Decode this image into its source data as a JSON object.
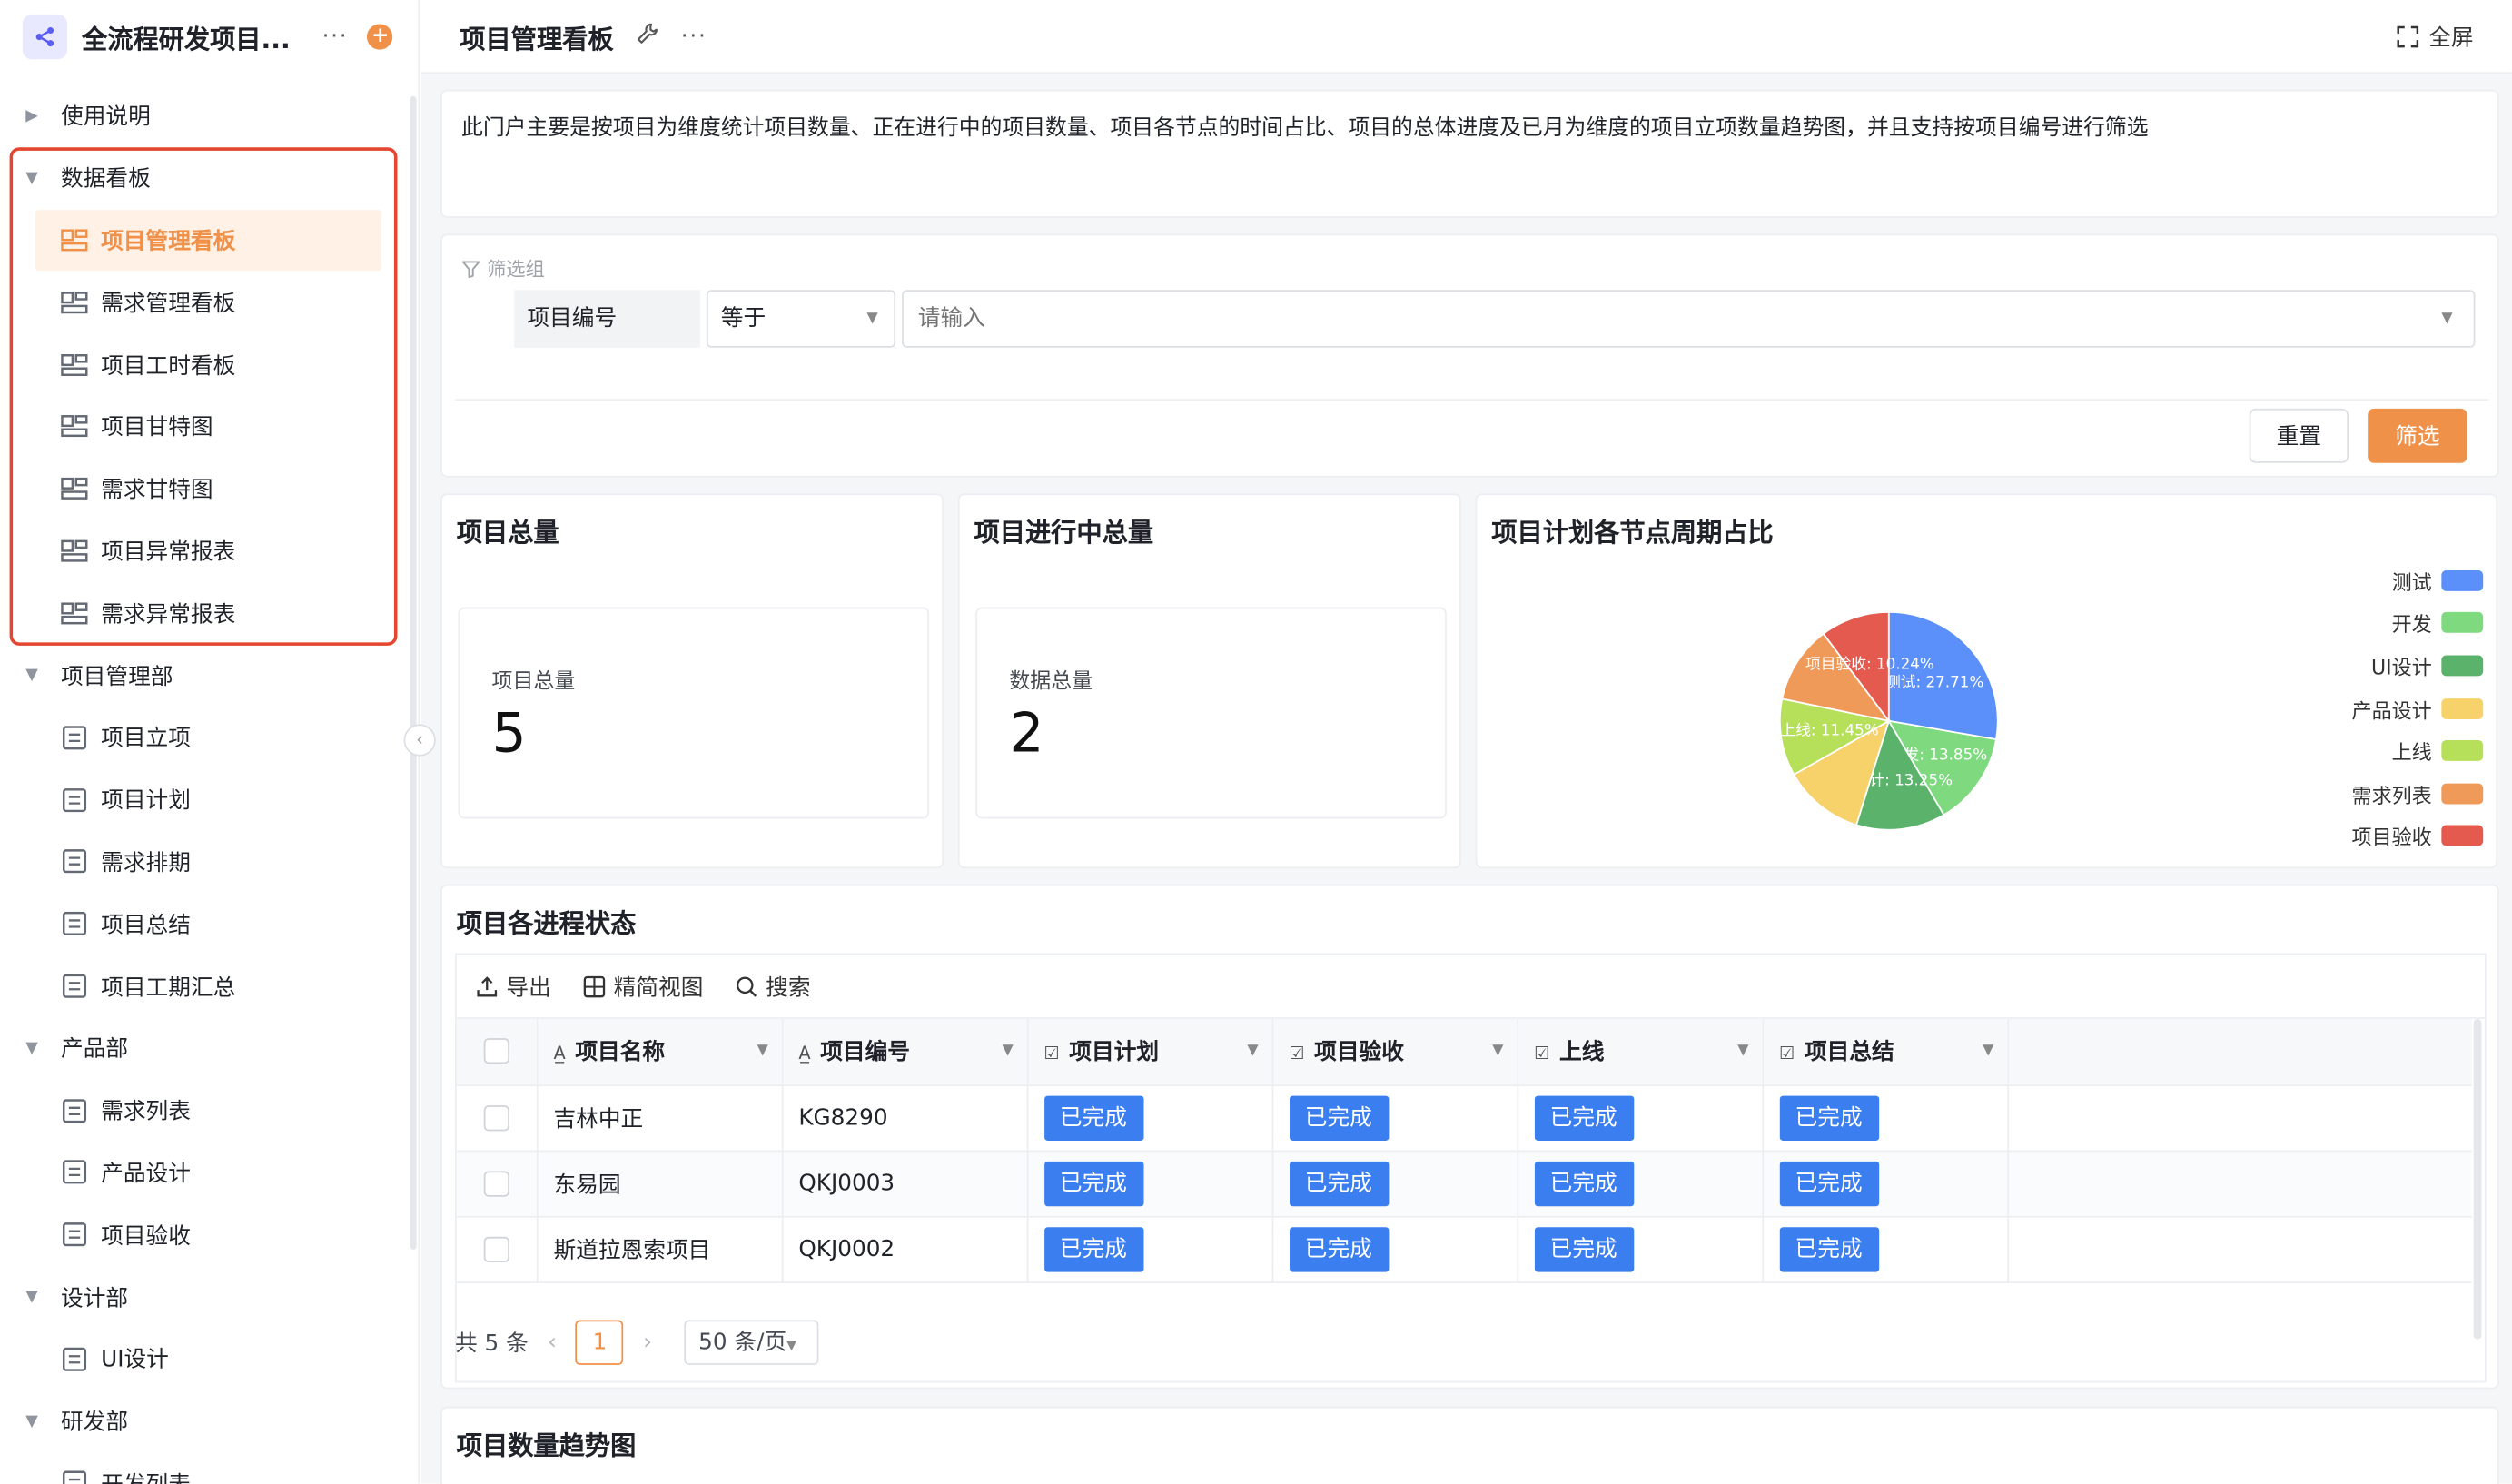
{
  "app": {
    "title": "全流程研发项目...",
    "more": "···",
    "add": "+"
  },
  "sidebar": {
    "groups": [
      {
        "label": "使用说明",
        "expanded": false,
        "items": []
      },
      {
        "label": "数据看板",
        "expanded": true,
        "items": [
          "项目管理看板",
          "需求管理看板",
          "项目工时看板",
          "项目甘特图",
          "需求甘特图",
          "项目异常报表",
          "需求异常报表"
        ]
      },
      {
        "label": "项目管理部",
        "expanded": true,
        "items": [
          "项目立项",
          "项目计划",
          "需求排期",
          "项目总结",
          "项目工期汇总"
        ]
      },
      {
        "label": "产品部",
        "expanded": true,
        "items": [
          "需求列表",
          "产品设计",
          "项目验收"
        ]
      },
      {
        "label": "设计部",
        "expanded": true,
        "items": [
          "UI设计"
        ]
      },
      {
        "label": "研发部",
        "expanded": true,
        "items": [
          "开发列表"
        ]
      }
    ],
    "active_item": "项目管理看板"
  },
  "topbar": {
    "title": "项目管理看板",
    "more": "···",
    "fullscreen": "全屏"
  },
  "description": "此门户主要是按项目为维度统计项目数量、正在进行中的项目数量、项目各节点的时间占比、项目的总体进度及已月为维度的项目立项数量趋势图，并且支持按项目编号进行筛选",
  "filter": {
    "group_label": "筛选组",
    "field": "项目编号",
    "operator": "等于",
    "placeholder": "请输入",
    "reset": "重置",
    "submit": "筛选"
  },
  "stats": [
    {
      "title": "项目总量",
      "label": "项目总量",
      "value": "5"
    },
    {
      "title": "项目进行中总量",
      "label": "数据总量",
      "value": "2"
    }
  ],
  "pie": {
    "title": "项目计划各节点周期占比",
    "legend": [
      {
        "name": "测试",
        "color": "#5b8ff9"
      },
      {
        "name": "开发",
        "color": "#7fd97f"
      },
      {
        "name": "UI设计",
        "color": "#5bb36b"
      },
      {
        "name": "产品设计",
        "color": "#f7d26a"
      },
      {
        "name": "上线",
        "color": "#b7e05a"
      },
      {
        "name": "需求列表",
        "color": "#f09a5a"
      },
      {
        "name": "项目验收",
        "color": "#e45a4f"
      }
    ]
  },
  "chart_data": {
    "type": "pie",
    "title": "项目计划各节点周期占比",
    "slices": [
      {
        "name": "测试",
        "value": 27.71,
        "label": "测试: 27.71%"
      },
      {
        "name": "开发",
        "value": 13.85,
        "label": "开发: 13.85%"
      },
      {
        "name": "UI设计",
        "value": 13.25,
        "label": "UI设计: 13.25%"
      },
      {
        "name": "产品设计",
        "value": 12.0,
        "label": ""
      },
      {
        "name": "上线",
        "value": 11.45,
        "label": "上线: 11.45%"
      },
      {
        "name": "需求列表",
        "value": 11.5,
        "label": ""
      },
      {
        "name": "项目验收",
        "value": 10.24,
        "label": "项目验收: 10.24%"
      }
    ],
    "legend_position": "right"
  },
  "table": {
    "title": "项目各进程状态",
    "toolbar": {
      "export": "导出",
      "compact": "精简视图",
      "search": "搜索"
    },
    "columns": [
      "项目名称",
      "项目编号",
      "项目计划",
      "项目验收",
      "上线",
      "项目总结"
    ],
    "rows": [
      {
        "name": "吉林中正",
        "code": "KG8290",
        "plan": "已完成",
        "accept": "已完成",
        "launch": "已完成",
        "summary": "已完成"
      },
      {
        "name": "东易园",
        "code": "QKJ0003",
        "plan": "已完成",
        "accept": "已完成",
        "launch": "已完成",
        "summary": "已完成"
      },
      {
        "name": "斯道拉恩索项目",
        "code": "QKJ0002",
        "plan": "已完成",
        "accept": "已完成",
        "launch": "已完成",
        "summary": "已完成"
      }
    ],
    "pager": {
      "total": "共 5 条",
      "current": "1",
      "page_size": "50 条/页"
    }
  },
  "trend": {
    "title": "项目数量趋势图"
  }
}
